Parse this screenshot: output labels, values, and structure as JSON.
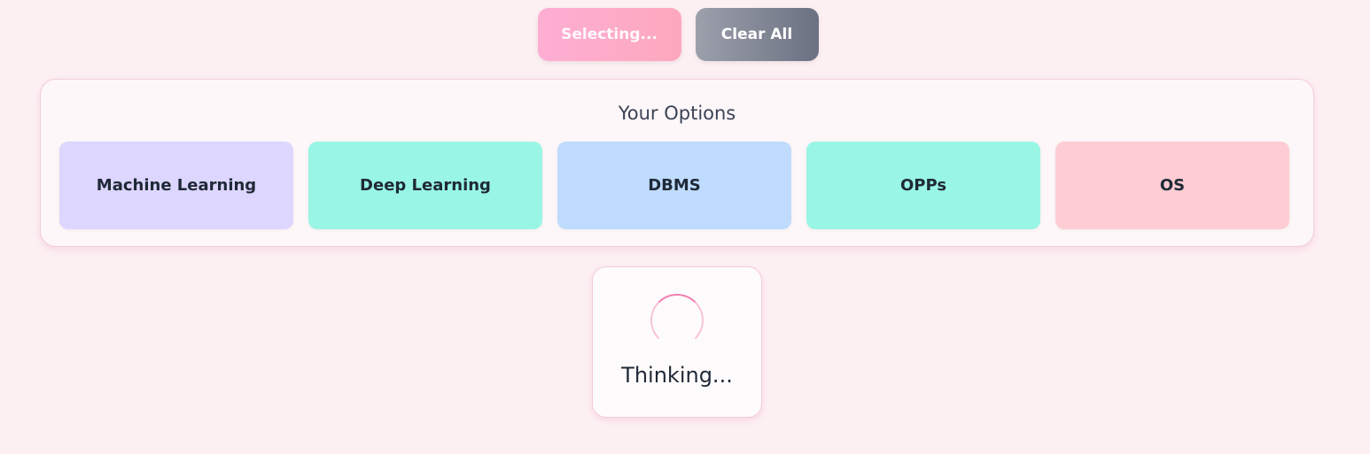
{
  "toolbar": {
    "selecting_label": "Selecting...",
    "clear_label": "Clear All"
  },
  "options": {
    "title": "Your Options",
    "items": [
      {
        "label": "Machine Learning",
        "color": "#ddd6fe"
      },
      {
        "label": "Deep Learning",
        "color": "#99f6e4"
      },
      {
        "label": "DBMS",
        "color": "#bfdbfe"
      },
      {
        "label": "OPPs",
        "color": "#99f6e4"
      },
      {
        "label": "OS",
        "color": "#fecdd3"
      }
    ]
  },
  "status": {
    "spinner_icon": "loading-spinner-icon",
    "text": "Thinking..."
  },
  "colors": {
    "background": "#fdf0f3",
    "accent_pink": "#f07fb0",
    "clear_button": "#6b7182"
  }
}
